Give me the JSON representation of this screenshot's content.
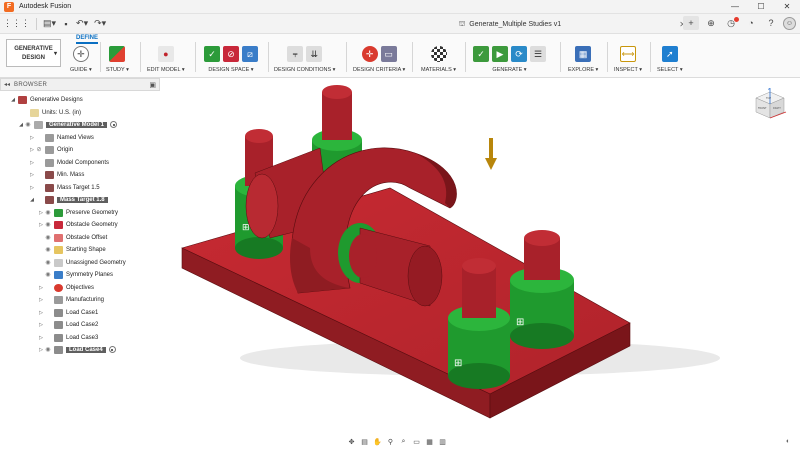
{
  "window": {
    "title": "Autodesk Fusion",
    "controls": [
      "—",
      "☐",
      "✕"
    ]
  },
  "document": {
    "title": "Generate_Multiple Studies v1"
  },
  "tabbar_icons": [
    "grid-icon",
    "file-icon",
    "save-icon",
    "undo-icon",
    "redo-icon"
  ],
  "toolbar": {
    "workspace": {
      "line1": "GENERATIVE",
      "line2": "DESIGN"
    },
    "active_tab": "DEFINE",
    "groups": [
      {
        "label": "GUIDE ▾"
      },
      {
        "label": "STUDY ▾"
      },
      {
        "label": "EDIT MODEL ▾"
      },
      {
        "label": "DESIGN SPACE ▾"
      },
      {
        "label": "DESIGN CONDITIONS ▾"
      },
      {
        "label": "DESIGN CRITERIA ▾"
      },
      {
        "label": "MATERIALS ▾"
      },
      {
        "label": "GENERATE ▾"
      },
      {
        "label": "EXPLORE ▾"
      },
      {
        "label": "INSPECT ▾"
      },
      {
        "label": "SELECT ▾"
      }
    ]
  },
  "browser": {
    "header": "BROWSER",
    "items": [
      {
        "label": "Generative Designs"
      },
      {
        "label": "Units: U.S. (in)"
      },
      {
        "label": "Generative Model 1"
      },
      {
        "label": "Named Views"
      },
      {
        "label": "Origin"
      },
      {
        "label": "Model Components"
      },
      {
        "label": "Min. Mass"
      },
      {
        "label": "Mass Target 1.5"
      },
      {
        "label": "Mass Target 1.8"
      },
      {
        "label": "Preserve Geometry"
      },
      {
        "label": "Obstacle Geometry"
      },
      {
        "label": "Obstacle Offset"
      },
      {
        "label": "Starting Shape"
      },
      {
        "label": "Unassigned Geometry"
      },
      {
        "label": "Symmetry Planes"
      },
      {
        "label": "Objectives"
      },
      {
        "label": "Manufacturing"
      },
      {
        "label": "Load Case1"
      },
      {
        "label": "Load Case2"
      },
      {
        "label": "Load Case3"
      },
      {
        "label": "Load Case4"
      }
    ]
  },
  "viewcube": {
    "labels": [
      "FRONT",
      "TOP",
      "RIGHT"
    ]
  },
  "colors": {
    "obstacle_red": "#b0232b",
    "preserve_green": "#1f9a2e",
    "accent_blue": "#0a6fc2",
    "load_arrow": "#b8860b"
  }
}
